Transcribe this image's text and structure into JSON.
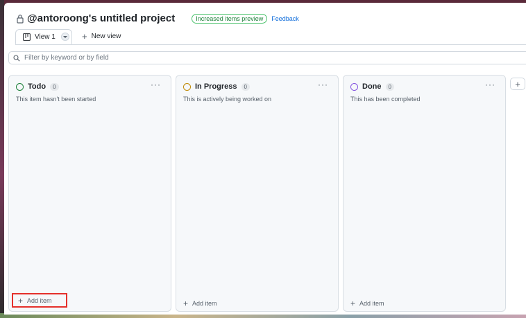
{
  "header": {
    "title": "@antoroong's untitled project",
    "badge": "Increased items preview",
    "feedback": "Feedback"
  },
  "tabs": {
    "current": "View 1",
    "new_view": "New view"
  },
  "filter": {
    "placeholder": "Filter by keyword or by field"
  },
  "columns": [
    {
      "name": "Todo",
      "count": "0",
      "description": "This item hasn't been started",
      "color": "#1a7f37",
      "add_label": "Add item"
    },
    {
      "name": "In Progress",
      "count": "0",
      "description": "This is actively being worked on",
      "color": "#bf8700",
      "add_label": "Add item"
    },
    {
      "name": "Done",
      "count": "0",
      "description": "This has been completed",
      "color": "#8250df",
      "add_label": "Add item"
    }
  ],
  "icons": {
    "more": "more-horizontal-icon",
    "add_column": "plus-icon"
  }
}
